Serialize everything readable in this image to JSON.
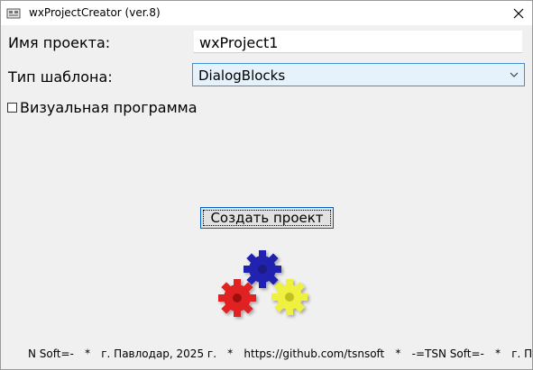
{
  "window": {
    "title": "wxProjectCreator (ver.8)"
  },
  "form": {
    "project_name_label": "Имя проекта:",
    "project_name_value": "wxProject1",
    "template_label": "Тип шаблона:",
    "template_value": "DialogBlocks",
    "visual_checkbox_label": "Визуальная программа",
    "visual_checked": false,
    "create_button": "Создать проект"
  },
  "gear_colors": {
    "red": "#e02020",
    "blue": "#2020b0",
    "yellow": "#f0f040"
  },
  "marquee": {
    "items": [
      "N Soft=-",
      "г. Павлодар, 2025 г.",
      "https://github.com/tsnsoft",
      "-=TSN Soft=-",
      "г. Павл"
    ],
    "separator": "✶"
  }
}
